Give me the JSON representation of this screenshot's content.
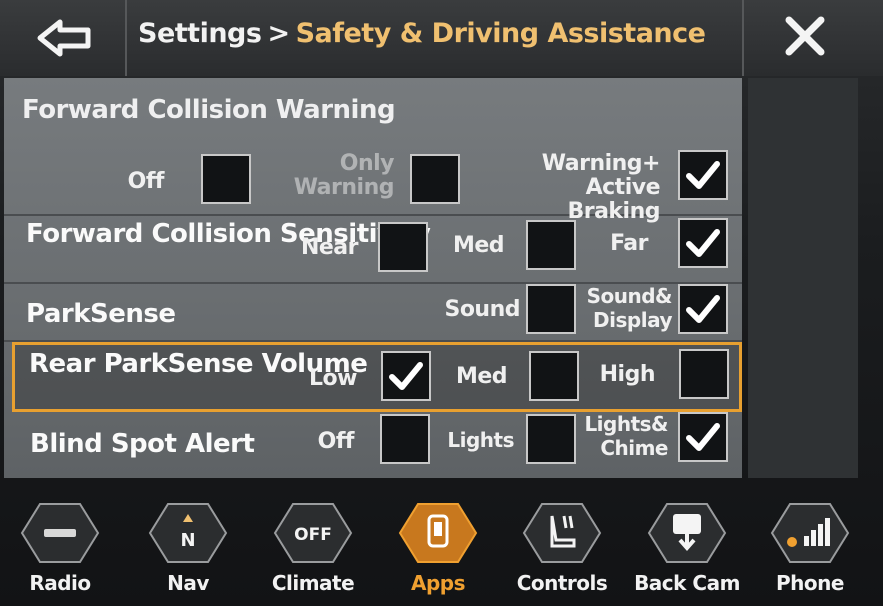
{
  "header": {
    "breadcrumb_root": "Settings",
    "breadcrumb_separator": ">",
    "breadcrumb_current": "Safety & Driving Assistance",
    "back_icon": "back-arrow-icon",
    "close_icon": "close-icon"
  },
  "settings": {
    "fcw": {
      "title": "Forward Collision Warning",
      "options": [
        {
          "label": "Off",
          "checked": false
        },
        {
          "label": "Only Warning",
          "checked": false
        },
        {
          "label": "Warning+ Active Braking",
          "checked": true
        }
      ]
    },
    "fcs": {
      "title": "Forward Collision Sensitivity",
      "options": [
        {
          "label": "Near",
          "checked": false
        },
        {
          "label": "Med",
          "checked": false
        },
        {
          "label": "Far",
          "checked": true
        }
      ]
    },
    "parksense": {
      "title": "ParkSense",
      "options": [
        {
          "label": "Sound",
          "checked": false
        },
        {
          "label": "Sound& Display",
          "checked": true
        }
      ]
    },
    "rear_volume": {
      "title": "Rear ParkSense Volume",
      "selected_row": true,
      "options": [
        {
          "label": "Low",
          "checked": true
        },
        {
          "label": "Med",
          "checked": false
        },
        {
          "label": "High",
          "checked": false
        }
      ]
    },
    "blind_spot": {
      "title": "Blind Spot Alert",
      "options": [
        {
          "label": "Off",
          "checked": false
        },
        {
          "label": "Lights",
          "checked": false
        },
        {
          "label": "Lights& Chime",
          "checked": true
        }
      ]
    }
  },
  "nav": {
    "items": [
      {
        "label": "Radio",
        "icon": "radio-icon",
        "active": false
      },
      {
        "label": "Nav",
        "icon": "compass-icon",
        "icon_text": "N",
        "active": false
      },
      {
        "label": "Climate",
        "icon": "climate-icon",
        "icon_text": "OFF",
        "active": false
      },
      {
        "label": "Apps",
        "icon": "apps-icon",
        "active": true
      },
      {
        "label": "Controls",
        "icon": "seat-controls-icon",
        "active": false
      },
      {
        "label": "Back Cam",
        "icon": "camera-icon",
        "active": false
      },
      {
        "label": "Phone",
        "icon": "phone-signal-icon",
        "active": false
      }
    ]
  },
  "colors": {
    "accent": "#f0a030",
    "breadcrumb_current": "#f0c070",
    "panel": "#6b6f72",
    "checkbox_fill": "#111315"
  }
}
